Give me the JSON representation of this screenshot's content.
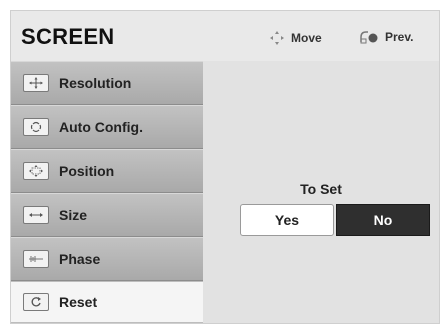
{
  "header": {
    "title": "SCREEN",
    "move_label": "Move",
    "prev_label": "Prev."
  },
  "menu": [
    {
      "label": "Resolution",
      "icon": "resolution-icon"
    },
    {
      "label": "Auto Config.",
      "icon": "auto-config-icon"
    },
    {
      "label": "Position",
      "icon": "position-icon"
    },
    {
      "label": "Size",
      "icon": "size-icon"
    },
    {
      "label": "Phase",
      "icon": "phase-icon"
    },
    {
      "label": "Reset",
      "icon": "reset-icon",
      "active": true
    }
  ],
  "dialog": {
    "prompt": "To Set",
    "yes_label": "Yes",
    "no_label": "No",
    "selected": "No"
  }
}
